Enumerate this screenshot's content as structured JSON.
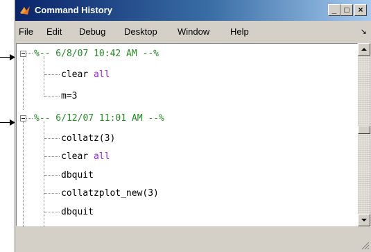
{
  "window": {
    "title": "Command History",
    "title_icon": "matlab-icon"
  },
  "title_buttons": {
    "minimize": "_",
    "maximize": "□",
    "close": "×"
  },
  "menu": [
    "File",
    "Edit",
    "Debug",
    "Desktop",
    "Window",
    "Help"
  ],
  "menu_undock": "↘",
  "history": {
    "sessions": [
      {
        "header": "%-- 6/8/07 10:42 AM --%",
        "commands": [
          {
            "code": "clear ",
            "kw": "all"
          },
          {
            "code": "m=3",
            "kw": ""
          }
        ]
      },
      {
        "header": "%-- 6/12/07 11:01 AM --%",
        "commands": [
          {
            "code": "collatz(3)",
            "kw": ""
          },
          {
            "code": "clear ",
            "kw": "all"
          },
          {
            "code": "dbquit",
            "kw": ""
          },
          {
            "code": "collatzplot_new(3)",
            "kw": ""
          },
          {
            "code": "dbquit",
            "kw": ""
          }
        ]
      }
    ]
  },
  "colors": {
    "comment": "#228b22",
    "keyword": "#a020f0",
    "titlebar": "#0a246a"
  }
}
